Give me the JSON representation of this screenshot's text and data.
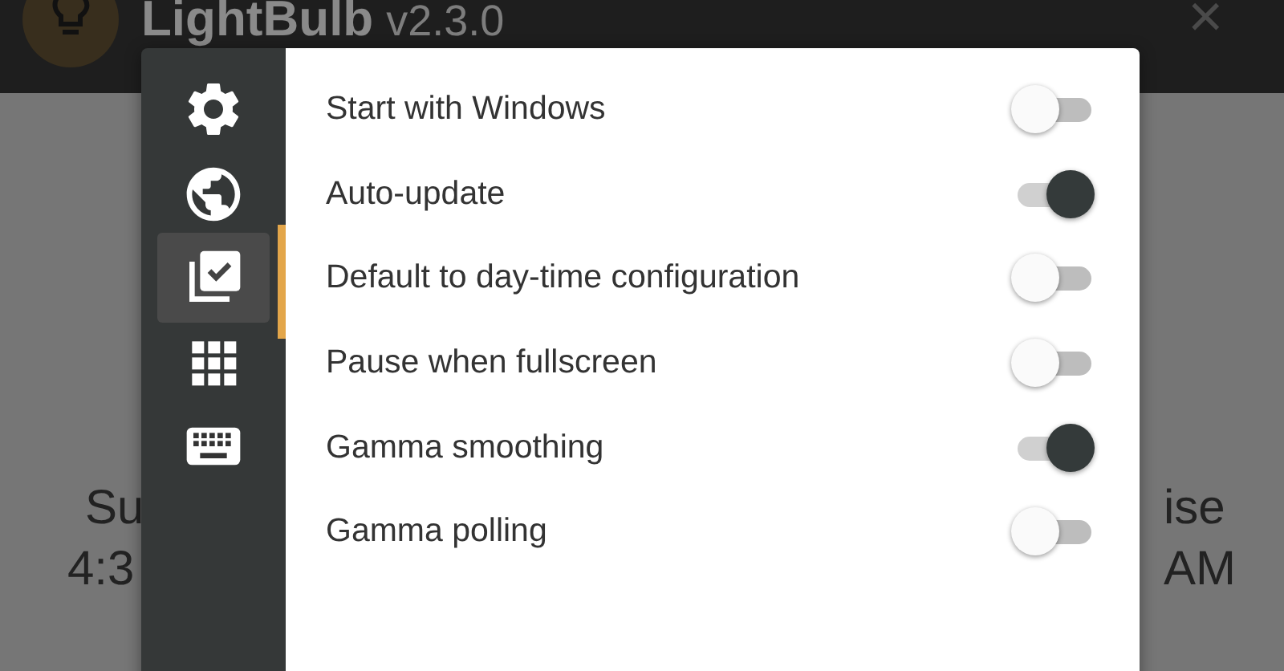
{
  "app": {
    "title": "LightBulb",
    "version": "v2.3.0",
    "close": "×",
    "left_label": "Su",
    "left_time": "4:3",
    "right_label": "ise",
    "right_time": "AM"
  },
  "sidebar": [
    {
      "kind": "gear",
      "selected": false
    },
    {
      "kind": "globe",
      "selected": false
    },
    {
      "kind": "checklist",
      "selected": true
    },
    {
      "kind": "grid",
      "selected": false
    },
    {
      "kind": "keyboard",
      "selected": false
    }
  ],
  "settings": [
    {
      "label": "Start with Windows",
      "on": false
    },
    {
      "label": "Auto-update",
      "on": true
    },
    {
      "label": "Default to day-time configuration",
      "on": false
    },
    {
      "label": "Pause when fullscreen",
      "on": false
    },
    {
      "label": "Gamma smoothing",
      "on": true
    },
    {
      "label": "Gamma polling",
      "on": false
    }
  ]
}
